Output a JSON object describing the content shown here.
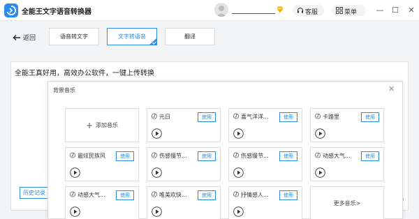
{
  "window": {
    "title": "全能王文字语音转换器",
    "service_label": "客服",
    "menu_label": "菜单",
    "minimize": "—",
    "maximize": "☐",
    "close": "✕"
  },
  "nav": {
    "back_label": "返回",
    "tabs": [
      {
        "label": "语音转文字",
        "active": false
      },
      {
        "label": "文字转语音",
        "active": true
      },
      {
        "label": "翻译",
        "active": false
      }
    ]
  },
  "editor": {
    "text": "全能王真好用，高效办公软件，一键上传转换",
    "history_label": "历史记录",
    "count_peek": "0"
  },
  "modal": {
    "title": "背景音乐",
    "close": "✕",
    "add_label": "添加音乐",
    "add_plus": "+",
    "use_label": "使用",
    "more_label": "更多音乐>",
    "songs": [
      {
        "name": "元日"
      },
      {
        "name": "喜气洋洋..."
      },
      {
        "name": "卡路里"
      },
      {
        "name": "最炫民族风"
      },
      {
        "name": "伤感慢节..."
      },
      {
        "name": "伤感慢节..."
      },
      {
        "name": "动感大气..."
      },
      {
        "name": "动感大气..."
      },
      {
        "name": "唯美欢快..."
      },
      {
        "name": "抒情感人..."
      }
    ]
  },
  "colors": {
    "accent": "#2b8cf0",
    "vip": "#f5b400"
  },
  "icons": {
    "app": "app-logo-icon",
    "vip": "vip-diamond-icon",
    "service": "headset-icon",
    "menu": "grid-icon",
    "back": "arrow-left-icon",
    "song": "music-note-icon",
    "play": "play-icon"
  }
}
